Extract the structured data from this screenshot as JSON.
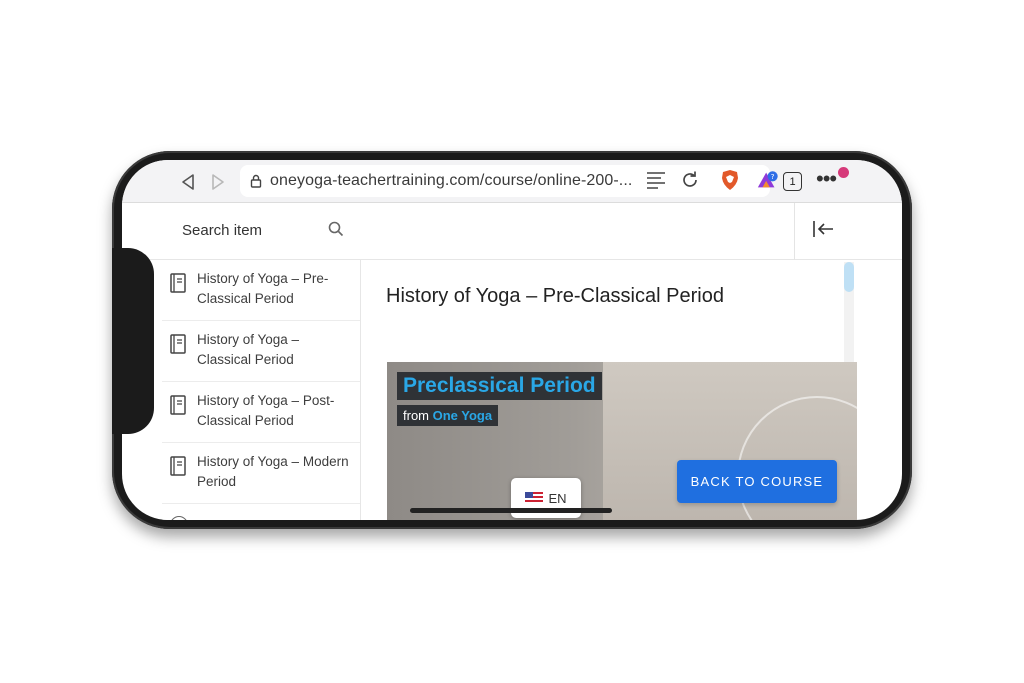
{
  "browser": {
    "url": "oneyoga-teachertraining.com/course/online-200-...",
    "tabs_count": "1",
    "more": "•••"
  },
  "course": {
    "search_label": "Search item",
    "lessons": [
      {
        "title": "History of Yoga – Pre-Classical Period"
      },
      {
        "title": "History of Yoga – Classical Period"
      },
      {
        "title": "History of Yoga – Post-Classical Period"
      },
      {
        "title": "History of Yoga – Modern Period"
      }
    ],
    "current_lesson_title": "History of Yoga – Pre-Classical Period",
    "back_button": "BACK TO COURSE"
  },
  "video": {
    "title": "Preclassical Period",
    "from_label": "from",
    "brand": "One Yoga",
    "language": "EN"
  },
  "colors": {
    "accent": "#1f6fe0",
    "video_title": "#2aa7e6",
    "brave": "#e2592a"
  }
}
